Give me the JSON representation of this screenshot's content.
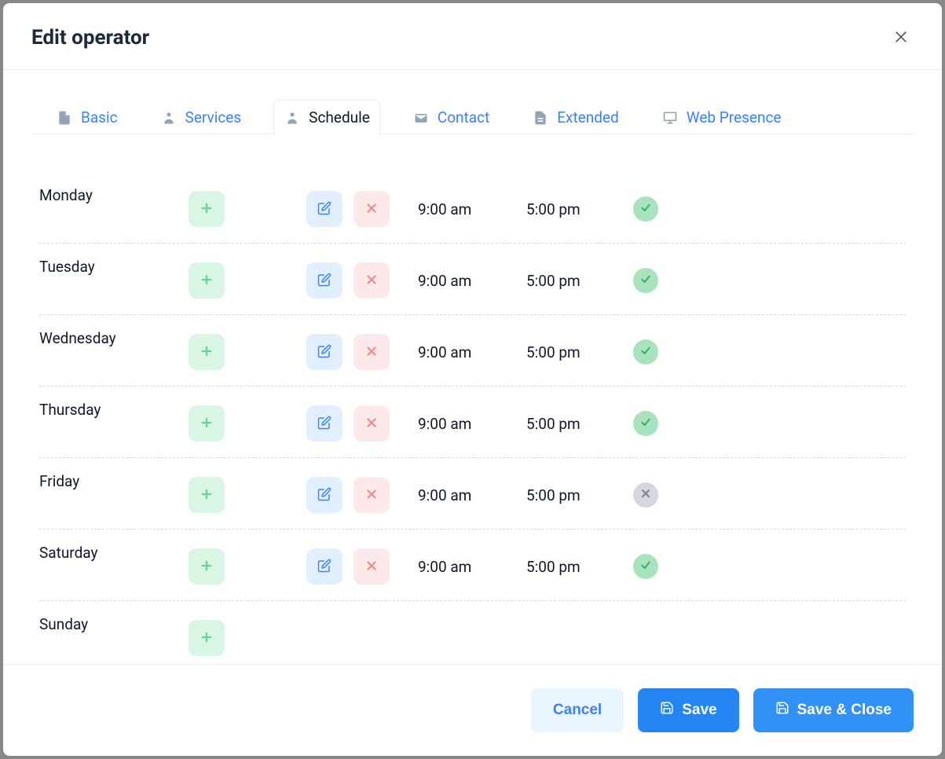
{
  "modal": {
    "title": "Edit operator"
  },
  "tabs": [
    {
      "id": "basic",
      "label": "Basic",
      "icon": "file"
    },
    {
      "id": "services",
      "label": "Services",
      "icon": "bell"
    },
    {
      "id": "schedule",
      "label": "Schedule",
      "icon": "bell",
      "active": true
    },
    {
      "id": "contact",
      "label": "Contact",
      "icon": "mail"
    },
    {
      "id": "extended",
      "label": "Extended",
      "icon": "doc"
    },
    {
      "id": "web",
      "label": "Web Presence",
      "icon": "screen"
    }
  ],
  "schedule": {
    "days": [
      {
        "name": "Monday",
        "slots": [
          {
            "start": "9:00 am",
            "end": "5:00 pm",
            "active": true
          }
        ]
      },
      {
        "name": "Tuesday",
        "slots": [
          {
            "start": "9:00 am",
            "end": "5:00 pm",
            "active": true
          }
        ]
      },
      {
        "name": "Wednesday",
        "slots": [
          {
            "start": "9:00 am",
            "end": "5:00 pm",
            "active": true
          }
        ]
      },
      {
        "name": "Thursday",
        "slots": [
          {
            "start": "9:00 am",
            "end": "5:00 pm",
            "active": true
          }
        ]
      },
      {
        "name": "Friday",
        "slots": [
          {
            "start": "9:00 am",
            "end": "5:00 pm",
            "active": false
          }
        ]
      },
      {
        "name": "Saturday",
        "slots": [
          {
            "start": "9:00 am",
            "end": "5:00 pm",
            "active": true
          }
        ]
      },
      {
        "name": "Sunday",
        "slots": []
      }
    ]
  },
  "footer": {
    "cancel": "Cancel",
    "save": "Save",
    "saveClose": "Save & Close"
  }
}
